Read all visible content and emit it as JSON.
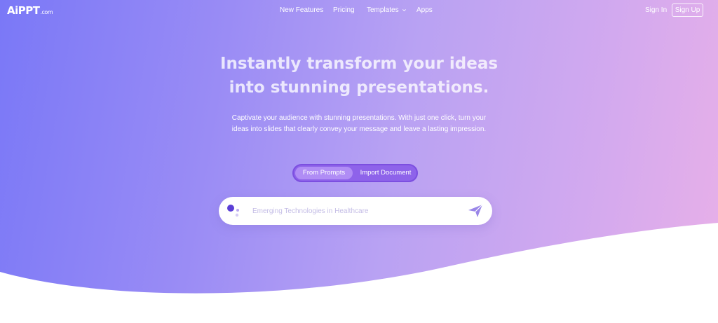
{
  "brand": {
    "logo_text": "AiPPT",
    "logo_domain": ".com"
  },
  "nav": {
    "items": [
      {
        "label": "New Features"
      },
      {
        "label": "Pricing"
      },
      {
        "label": "Templates"
      },
      {
        "label": "Apps"
      }
    ],
    "sign_in": "Sign In",
    "sign_up": "Sign Up"
  },
  "hero": {
    "headline_line1": "Instantly transform your ideas",
    "headline_line2": "into stunning presentations.",
    "subtext_line1": "Captivate your audience with stunning presentations. With just one click, turn your",
    "subtext_line2": "ideas into slides that clearly convey your message and leave a lasting impression."
  },
  "mode_toggle": {
    "options": [
      {
        "label": "From Prompts",
        "selected": true
      },
      {
        "label": "Import Document",
        "selected": false
      }
    ]
  },
  "search": {
    "placeholder": "Emerging Technologies in Healthcare",
    "value": ""
  },
  "icons": {
    "ai": "ai-assistant-icon",
    "send": "send-icon",
    "chevron": "chevron-down-icon"
  },
  "colors": {
    "accent": "#8e63ea",
    "toggle_active": "#b08df5",
    "send_icon": "#9a86e8",
    "ai_dot_dark": "#5b3fd6",
    "ai_dot_light": "#b9a8f0"
  }
}
